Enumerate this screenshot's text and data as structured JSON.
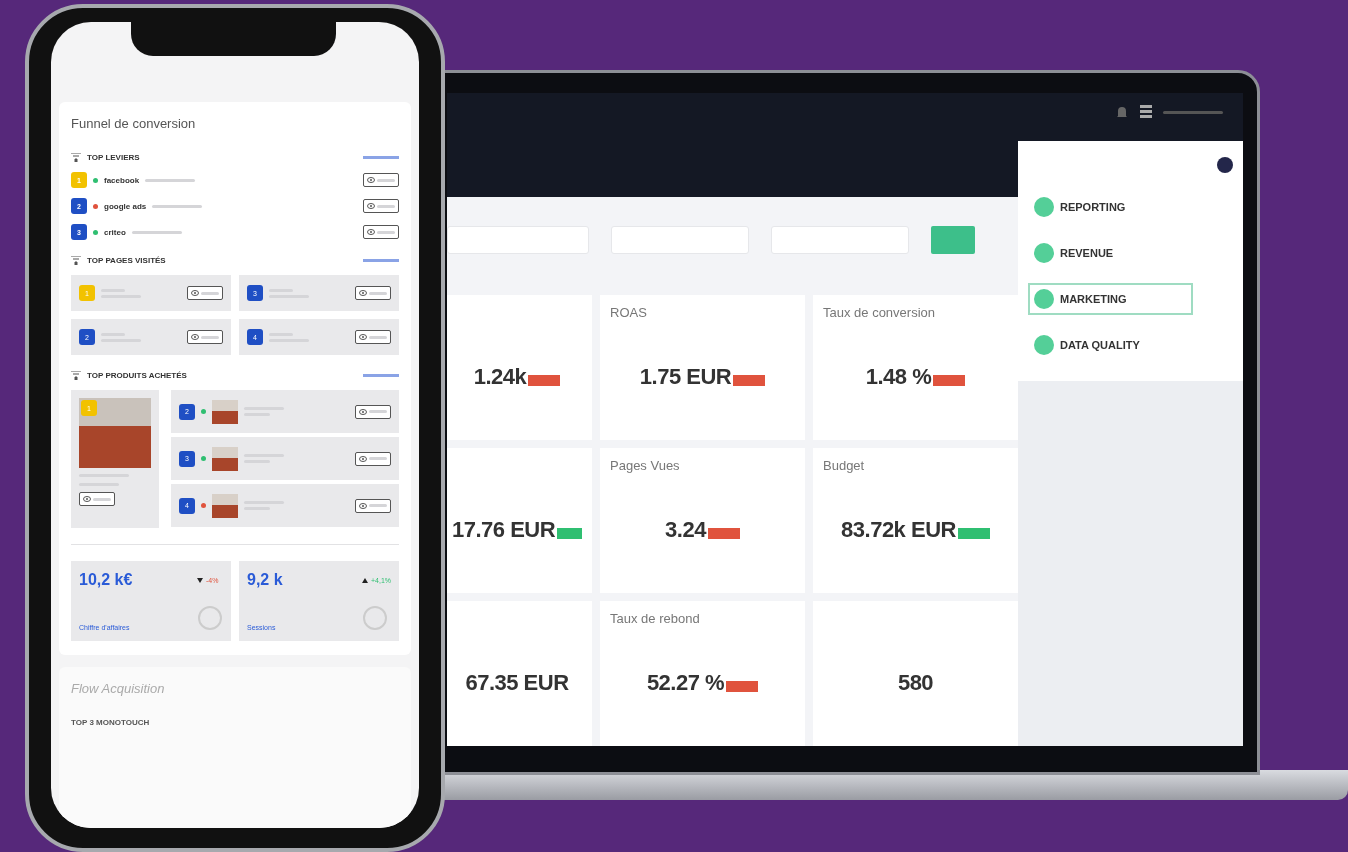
{
  "phone": {
    "funnel_title": "Funnel de conversion",
    "top_leviers": {
      "title": "TOP LEVIERS",
      "items": [
        {
          "rank": "1",
          "color": "#f2c200",
          "rising": true,
          "name": "facebook"
        },
        {
          "rank": "2",
          "color": "#1f4fc4",
          "rising": false,
          "name": "google ads"
        },
        {
          "rank": "3",
          "color": "#1f4fc4",
          "rising": true,
          "name": "criteo"
        }
      ]
    },
    "top_pages": {
      "title": "TOP PAGES VISITÉS",
      "items": [
        {
          "rank": "1",
          "color": "#f2c200"
        },
        {
          "rank": "3",
          "color": "#1f4fc4"
        },
        {
          "rank": "2",
          "color": "#1f4fc4"
        },
        {
          "rank": "4",
          "color": "#1f4fc4"
        }
      ]
    },
    "top_produits": {
      "title": "TOP PRODUITS ACHETÉS",
      "featured": {
        "rank": "1",
        "color": "#f2c200"
      },
      "items": [
        {
          "rank": "2",
          "color": "#1f4fc4",
          "rising": true
        },
        {
          "rank": "3",
          "color": "#1f4fc4",
          "rising": true
        },
        {
          "rank": "4",
          "color": "#1f4fc4",
          "rising": false
        }
      ]
    },
    "kpis": [
      {
        "value": "10,2 k€",
        "delta": "-4%",
        "rising": false,
        "label": "Chiffre d'affaires"
      },
      {
        "value": "9,2 k",
        "delta": "+4,1%",
        "rising": true,
        "label": "Sessions"
      }
    ],
    "flow_title": "Flow Acquisition",
    "flow_section": "TOP 3 MONOTOUCH"
  },
  "laptop": {
    "tiles": [
      {
        "value": "1.24k",
        "rising": false
      },
      {
        "label": "ROAS",
        "value": "1.75 EUR",
        "rising": false
      },
      {
        "label": "Taux de conversion",
        "value": "1.48 %",
        "rising": false
      },
      {
        "value": "17.76 EUR",
        "rising": true
      },
      {
        "label": "Pages Vues",
        "value": "3.24",
        "rising": false
      },
      {
        "label": "Budget",
        "value": "83.72k EUR",
        "rising": true
      },
      {
        "value": "67.35 EUR"
      },
      {
        "label": "Taux de rebond",
        "value": "52.27 %",
        "rising": false
      },
      {
        "value": "580"
      }
    ],
    "menu": [
      {
        "label": "REPORTING",
        "selected": false
      },
      {
        "label": "REVENUE",
        "selected": false
      },
      {
        "label": "MARKETING",
        "selected": true
      },
      {
        "label": "DATA QUALITY",
        "selected": false
      }
    ]
  }
}
